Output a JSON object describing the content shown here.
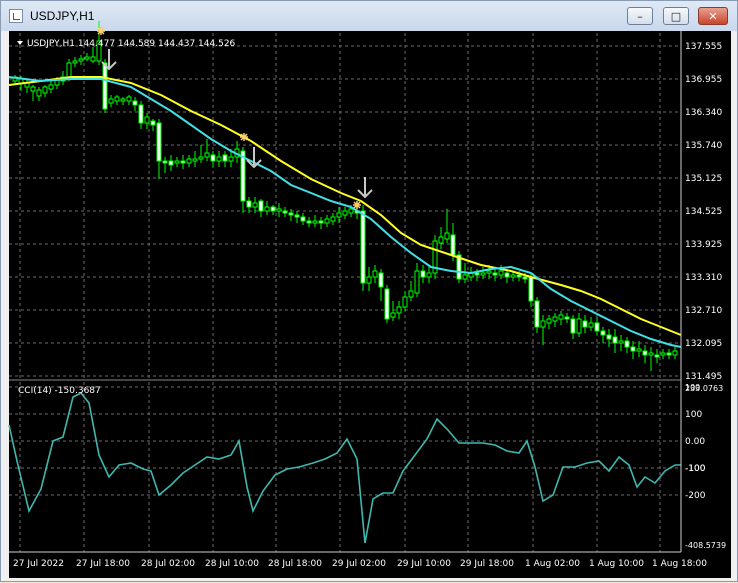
{
  "window": {
    "title": "USDJPY,H1"
  },
  "main_chart": {
    "info": "USDJPY,H1  144.477 144.589 144.437 144.526",
    "price_labels": [
      "137.555",
      "136.955",
      "136.340",
      "135.740",
      "135.125",
      "134.525",
      "133.925",
      "133.310",
      "132.710",
      "132.095",
      "131.495"
    ],
    "colors": {
      "bull": "#00ff00",
      "ma_fast": "#40e0e8",
      "ma_slow": "#ffff20",
      "grid": "#6a6a6a",
      "text": "#ffffff"
    }
  },
  "indicator": {
    "label": "CCI(14) -150.3687",
    "levels": [
      "233.0763",
      "100",
      "100",
      "0.00",
      "-100",
      "-100",
      "-200",
      "-408.5739"
    ]
  },
  "time_labels": [
    "27 Jul 2022",
    "27 Jul 18:00",
    "28 Jul 02:00",
    "28 Jul 10:00",
    "28 Jul 18:00",
    "29 Jul 02:00",
    "29 Jul 10:00",
    "29 Jul 18:00",
    "1 Aug 02:00",
    "1 Aug 10:00",
    "1 Aug 18:00"
  ]
}
